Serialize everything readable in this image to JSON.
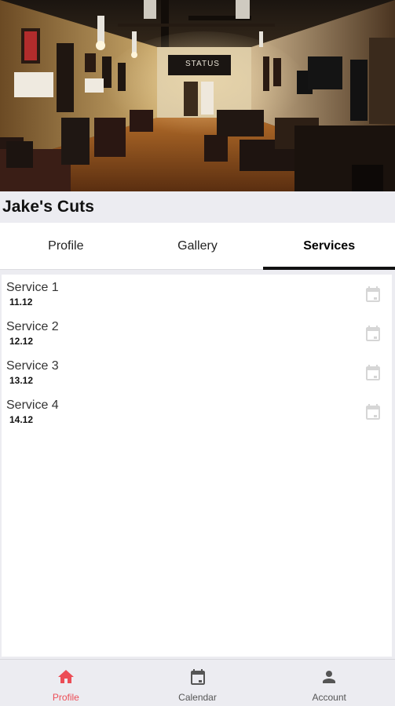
{
  "hero": {
    "image": "barbershop-interior-photo",
    "sign_text": "STATUS"
  },
  "shop": {
    "name": "Jake's Cuts"
  },
  "tabs": [
    {
      "label": "Profile",
      "active": false
    },
    {
      "label": "Gallery",
      "active": false
    },
    {
      "label": "Services",
      "active": true
    }
  ],
  "services": [
    {
      "name": "Service 1",
      "value": "11.12",
      "icon": "calendar-icon"
    },
    {
      "name": "Service 2",
      "value": "12.12",
      "icon": "calendar-icon"
    },
    {
      "name": "Service 3",
      "value": "13.12",
      "icon": "calendar-icon"
    },
    {
      "name": "Service 4",
      "value": "14.12",
      "icon": "calendar-icon"
    }
  ],
  "bottom_nav": [
    {
      "label": "Profile",
      "icon": "home-icon",
      "active": true
    },
    {
      "label": "Calendar",
      "icon": "calendar-icon",
      "active": false
    },
    {
      "label": "Account",
      "icon": "person-icon",
      "active": false
    }
  ],
  "colors": {
    "accent": "#ec4d56",
    "tab_indicator": "#111111",
    "background": "#ececf1",
    "icon_gray": "#555555",
    "icon_light": "#d6d6d6"
  }
}
